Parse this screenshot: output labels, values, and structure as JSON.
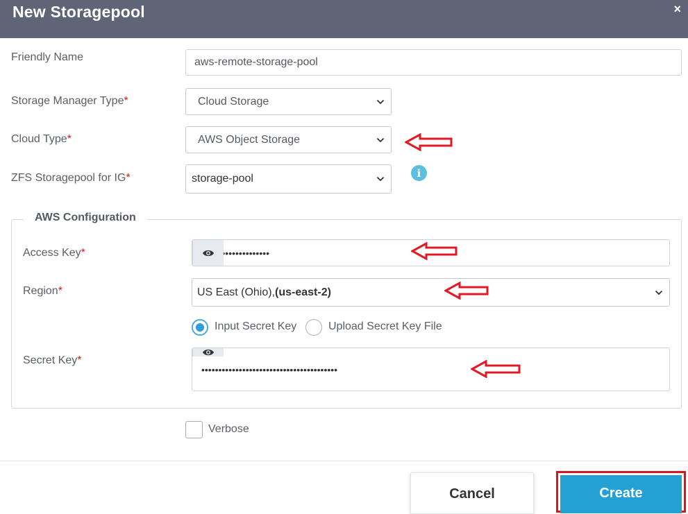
{
  "dialog": {
    "title": "New Storagepool",
    "close_label": "×"
  },
  "form": {
    "friendly_name": {
      "label": "Friendly Name",
      "value": "aws-remote-storage-pool"
    },
    "storage_manager_type": {
      "label": "Storage Manager Type",
      "required": "*",
      "value": "Cloud Storage"
    },
    "cloud_type": {
      "label": "Cloud Type",
      "required": "*",
      "value": "AWS Object Storage"
    },
    "zfs_storagepool": {
      "label": "ZFS Storagepool for IG",
      "required": "*",
      "value": "storage-pool",
      "info_icon": "info-circle-icon"
    },
    "aws_config": {
      "legend": "AWS Configuration",
      "access_key": {
        "label": "Access Key",
        "required": "*",
        "value": "••••••••••••••••••••"
      },
      "region": {
        "label": "Region",
        "required": "*",
        "value_plain": "US East (Ohio),",
        "value_bold": "(us-east-2)"
      },
      "secret_mode": {
        "options": [
          "Input Secret Key",
          "Upload Secret Key File"
        ],
        "selected": "Input Secret Key"
      },
      "secret_key": {
        "label": "Secret Key",
        "required": "*",
        "value": "••••••••••••••••••••••••••••••••••••••••"
      }
    },
    "verbose": {
      "label": "Verbose",
      "checked": false
    }
  },
  "footer": {
    "cancel_label": "Cancel",
    "create_label": "Create"
  },
  "colors": {
    "header_bg": "#5f6577",
    "primary": "#24a0d4",
    "annotation_red": "#d8161f",
    "info": "#5bc0de"
  }
}
